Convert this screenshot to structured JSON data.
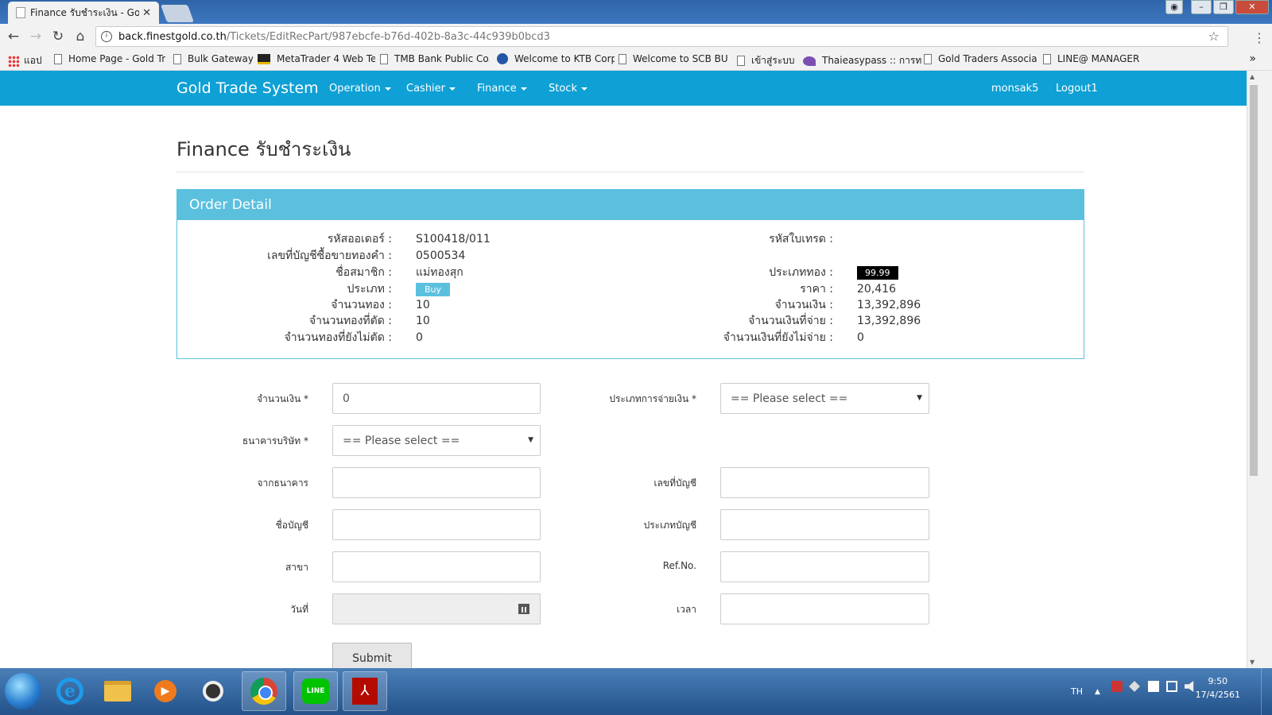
{
  "browser": {
    "tab_title": "Finance รับชำระเงิน - Gold",
    "tab_close": "✕",
    "url_host": "back.finestgold.co.th",
    "url_path": "/Tickets/EditRecPart/987ebcfe-b76d-402b-8a3c-44c939b0bcd3",
    "bookmarks": [
      {
        "label": "แอป",
        "icon": "apps-icon"
      },
      {
        "label": "Home Page - Gold Tr",
        "icon": "page-icon"
      },
      {
        "label": "Bulk Gateway",
        "icon": "page-icon"
      },
      {
        "label": "MetaTrader 4 Web Te",
        "icon": "metatrader-icon"
      },
      {
        "label": "TMB Bank Public Co.",
        "icon": "page-icon"
      },
      {
        "label": "Welcome to KTB Corp",
        "icon": "ktb-icon"
      },
      {
        "label": "Welcome to SCB BUS",
        "icon": "page-icon"
      },
      {
        "label": "เข้าสู่ระบบ",
        "icon": "page-icon"
      },
      {
        "label": "Thaieasypass :: การท",
        "icon": "thaieasypass-icon"
      },
      {
        "label": "Gold Traders Associa",
        "icon": "page-icon"
      },
      {
        "label": "LINE@ MANAGER",
        "icon": "page-icon"
      }
    ],
    "bookmarks_more": "»"
  },
  "navbar": {
    "brand": "Gold Trade System",
    "menus": [
      "Operation",
      "Cashier",
      "Finance",
      "Stock"
    ],
    "user": "monsak5",
    "logout": "Logout1"
  },
  "page": {
    "title": "Finance รับชำระเงิน"
  },
  "order_detail": {
    "heading": "Order Detail",
    "left": [
      {
        "label": "รหัสออเดอร์ :",
        "value": "S100418/011"
      },
      {
        "label": "เลขที่บัญชีซื้อขายทองคำ :",
        "value": "0500534"
      },
      {
        "label": "ชื่อสมาชิก :",
        "value": "แม่ทองสุก"
      },
      {
        "label": "ประเภท :",
        "value": "Buy"
      },
      {
        "label": "จำนวนทอง :",
        "value": "10"
      },
      {
        "label": "จำนวนทองที่ตัด :",
        "value": "10"
      },
      {
        "label": "จำนวนทองที่ยังไม่ตัด :",
        "value": "0"
      }
    ],
    "right": [
      {
        "label": "รหัสใบเทรด :",
        "value": ""
      },
      {
        "label": "ประเภททอง :",
        "value": "99.99"
      },
      {
        "label": "ราคา :",
        "value": "20,416"
      },
      {
        "label": "จำนวนเงิน :",
        "value": "13,392,896"
      },
      {
        "label": "จำนวนเงินที่จ่าย :",
        "value": "13,392,896"
      },
      {
        "label": "จำนวนเงินที่ยังไม่จ่าย :",
        "value": "0"
      }
    ]
  },
  "form": {
    "amount_label": "จำนวนเงิน *",
    "amount_value": "0",
    "pay_type_label": "ประเภทการจ่ายเงิน *",
    "pay_type_value": "== Please select ==",
    "company_bank_label": "ธนาคารบริษัท *",
    "company_bank_value": "== Please select ==",
    "from_bank_label": "จากธนาคาร",
    "account_no_label": "เลขที่บัญชี",
    "account_name_label": "ชื่อบัญชี",
    "account_type_label": "ประเภทบัญชี",
    "branch_label": "สาขา",
    "ref_label": "Ref.No.",
    "date_label": "วันที่",
    "time_label": "เวลา",
    "submit": "Submit"
  },
  "taskbar": {
    "language": "TH",
    "time": "9:50",
    "date": "17/4/2561"
  },
  "colors": {
    "navbar": "#0fa0d5",
    "panel_heading": "#5bc0de",
    "badge_buy": "#5bc0de",
    "badge_gold": "#000000"
  }
}
